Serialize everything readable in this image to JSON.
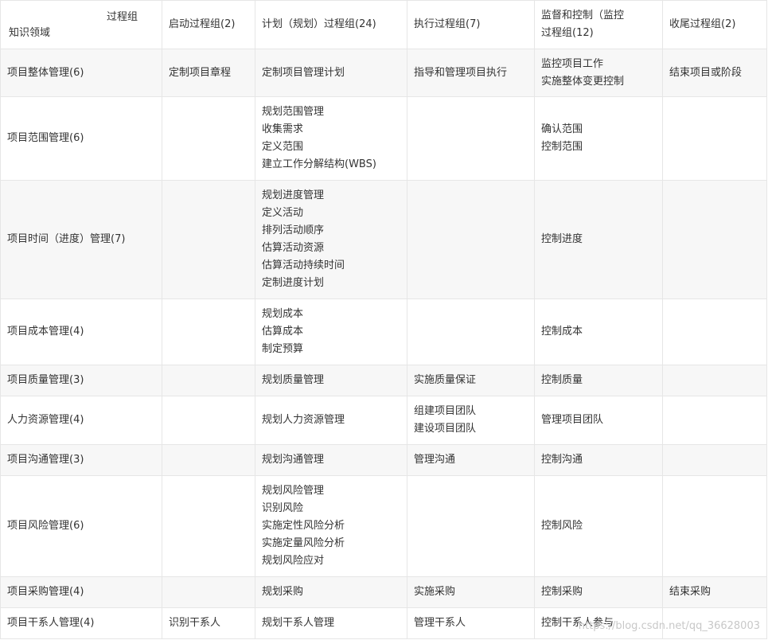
{
  "header": {
    "corner_top": "过程组",
    "corner_bottom": "知识领域",
    "columns": [
      [
        "启动过程组(2)"
      ],
      [
        "计划（规划）过程组(24)"
      ],
      [
        "执行过程组(7)"
      ],
      [
        "监督和控制（监控",
        "过程组(12)"
      ],
      [
        "收尾过程组(2)"
      ]
    ]
  },
  "rows": [
    {
      "area": "项目整体管理(6)",
      "cells": [
        [
          "定制项目章程"
        ],
        [
          "定制项目管理计划"
        ],
        [
          "指导和管理项目执行"
        ],
        [
          "监控项目工作",
          "实施整体变更控制"
        ],
        [
          "结束项目或阶段"
        ]
      ]
    },
    {
      "area": "项目范围管理(6)",
      "cells": [
        [],
        [
          "规划范围管理",
          "收集需求",
          "定义范围",
          "建立工作分解结构(WBS)"
        ],
        [],
        [
          "确认范围",
          "控制范围"
        ],
        []
      ]
    },
    {
      "area": "项目时间（进度）管理(7)",
      "cells": [
        [],
        [
          "规划进度管理",
          "定义活动",
          "排列活动顺序",
          "估算活动资源",
          "估算活动持续时间",
          "定制进度计划"
        ],
        [],
        [
          "控制进度"
        ],
        []
      ]
    },
    {
      "area": "项目成本管理(4)",
      "cells": [
        [],
        [
          "规划成本",
          "估算成本",
          "制定预算"
        ],
        [],
        [
          "控制成本"
        ],
        []
      ]
    },
    {
      "area": "项目质量管理(3)",
      "cells": [
        [],
        [
          "规划质量管理"
        ],
        [
          "实施质量保证"
        ],
        [
          "控制质量"
        ],
        []
      ]
    },
    {
      "area": "人力资源管理(4)",
      "cells": [
        [],
        [
          "规划人力资源管理"
        ],
        [
          "组建项目团队",
          "建设项目团队"
        ],
        [
          "管理项目团队"
        ],
        []
      ]
    },
    {
      "area": "项目沟通管理(3)",
      "cells": [
        [],
        [
          "规划沟通管理"
        ],
        [
          "管理沟通"
        ],
        [
          "控制沟通"
        ],
        []
      ]
    },
    {
      "area": "项目风险管理(6)",
      "cells": [
        [],
        [
          "规划风险管理",
          "识别风险",
          "实施定性风险分析",
          "实施定量风险分析",
          "规划风险应对"
        ],
        [],
        [
          "控制风险"
        ],
        []
      ]
    },
    {
      "area": "项目采购管理(4)",
      "cells": [
        [],
        [
          "规划采购"
        ],
        [
          "实施采购"
        ],
        [
          "控制采购"
        ],
        [
          "结束采购"
        ]
      ]
    },
    {
      "area": "项目干系人管理(4)",
      "cells": [
        [
          "识别干系人"
        ],
        [
          "规划干系人管理"
        ],
        [
          "管理干系人"
        ],
        [
          "控制干系人参与"
        ],
        []
      ]
    }
  ],
  "watermark": "https://blog.csdn.net/qq_36628003"
}
